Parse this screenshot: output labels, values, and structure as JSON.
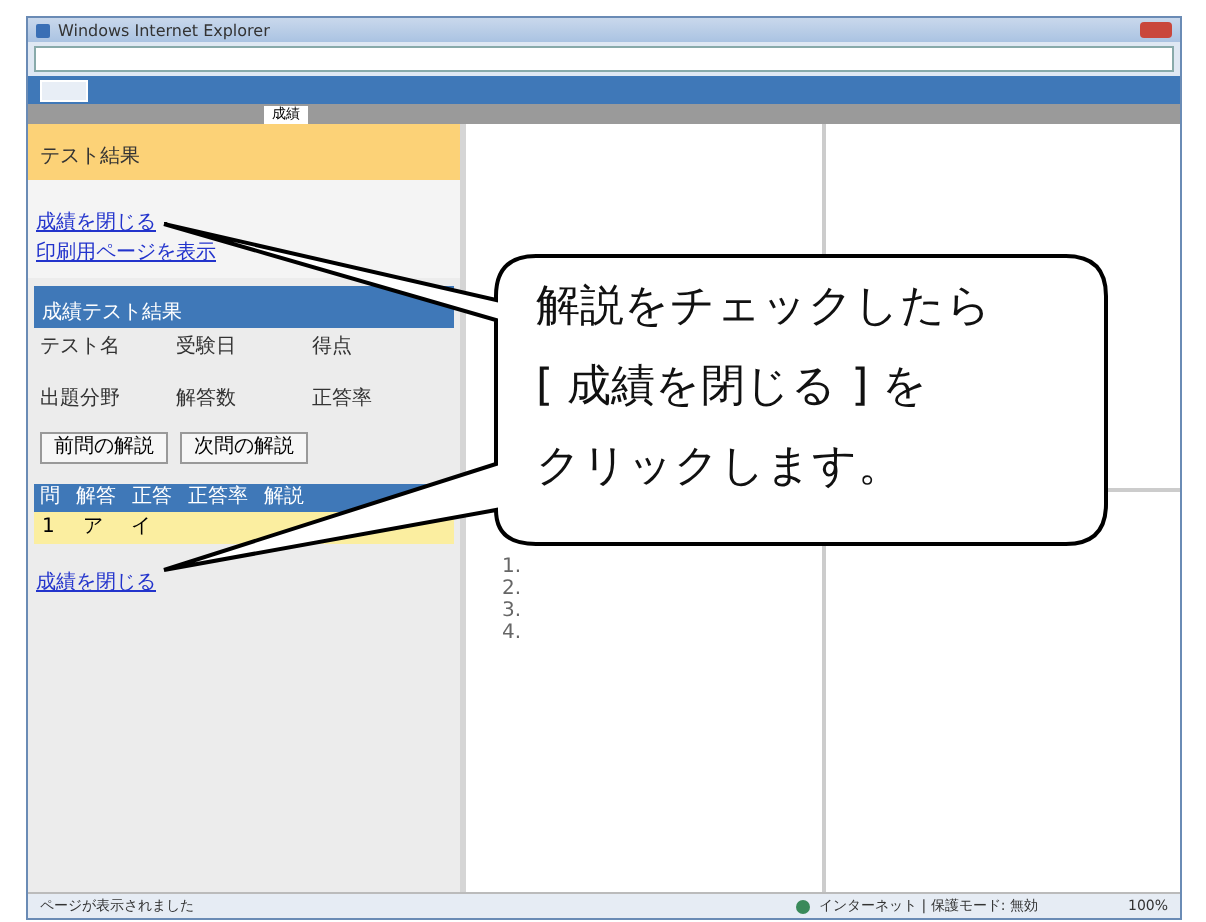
{
  "window": {
    "title": "Windows Internet Explorer"
  },
  "app": {
    "tab_label": "成績"
  },
  "left": {
    "title": "テスト結果",
    "links": [
      {
        "label": "成績を閉じる"
      },
      {
        "label": "印刷用ページを表示"
      }
    ],
    "section_title": "成績テスト結果",
    "fields": [
      {
        "label": "テスト名"
      },
      {
        "label": "受験日"
      },
      {
        "label": "得点"
      },
      {
        "label": "出題分野"
      },
      {
        "label": "解答数"
      },
      {
        "label": "正答率"
      }
    ],
    "buttons": [
      "前問の解説",
      "次問の解説"
    ],
    "table": {
      "columns": [
        "問",
        "解答",
        "正答",
        "正答率",
        "解説"
      ],
      "rows": [
        {
          "cells": [
            "1",
            "ア",
            "イ"
          ],
          "selected": true
        }
      ]
    },
    "bottom_link": "成績を閉じる"
  },
  "middle": {
    "list": [
      "1.",
      "2.",
      "3.",
      "4."
    ]
  },
  "status_bar": {
    "left": "ページが表示されました",
    "zone": "インターネット | 保護モード: 無効",
    "zoom": "100%"
  },
  "callout": {
    "lines": [
      "解説をチェックしたら",
      "[ 成績を閉じる ] を",
      "クリックします。"
    ]
  }
}
